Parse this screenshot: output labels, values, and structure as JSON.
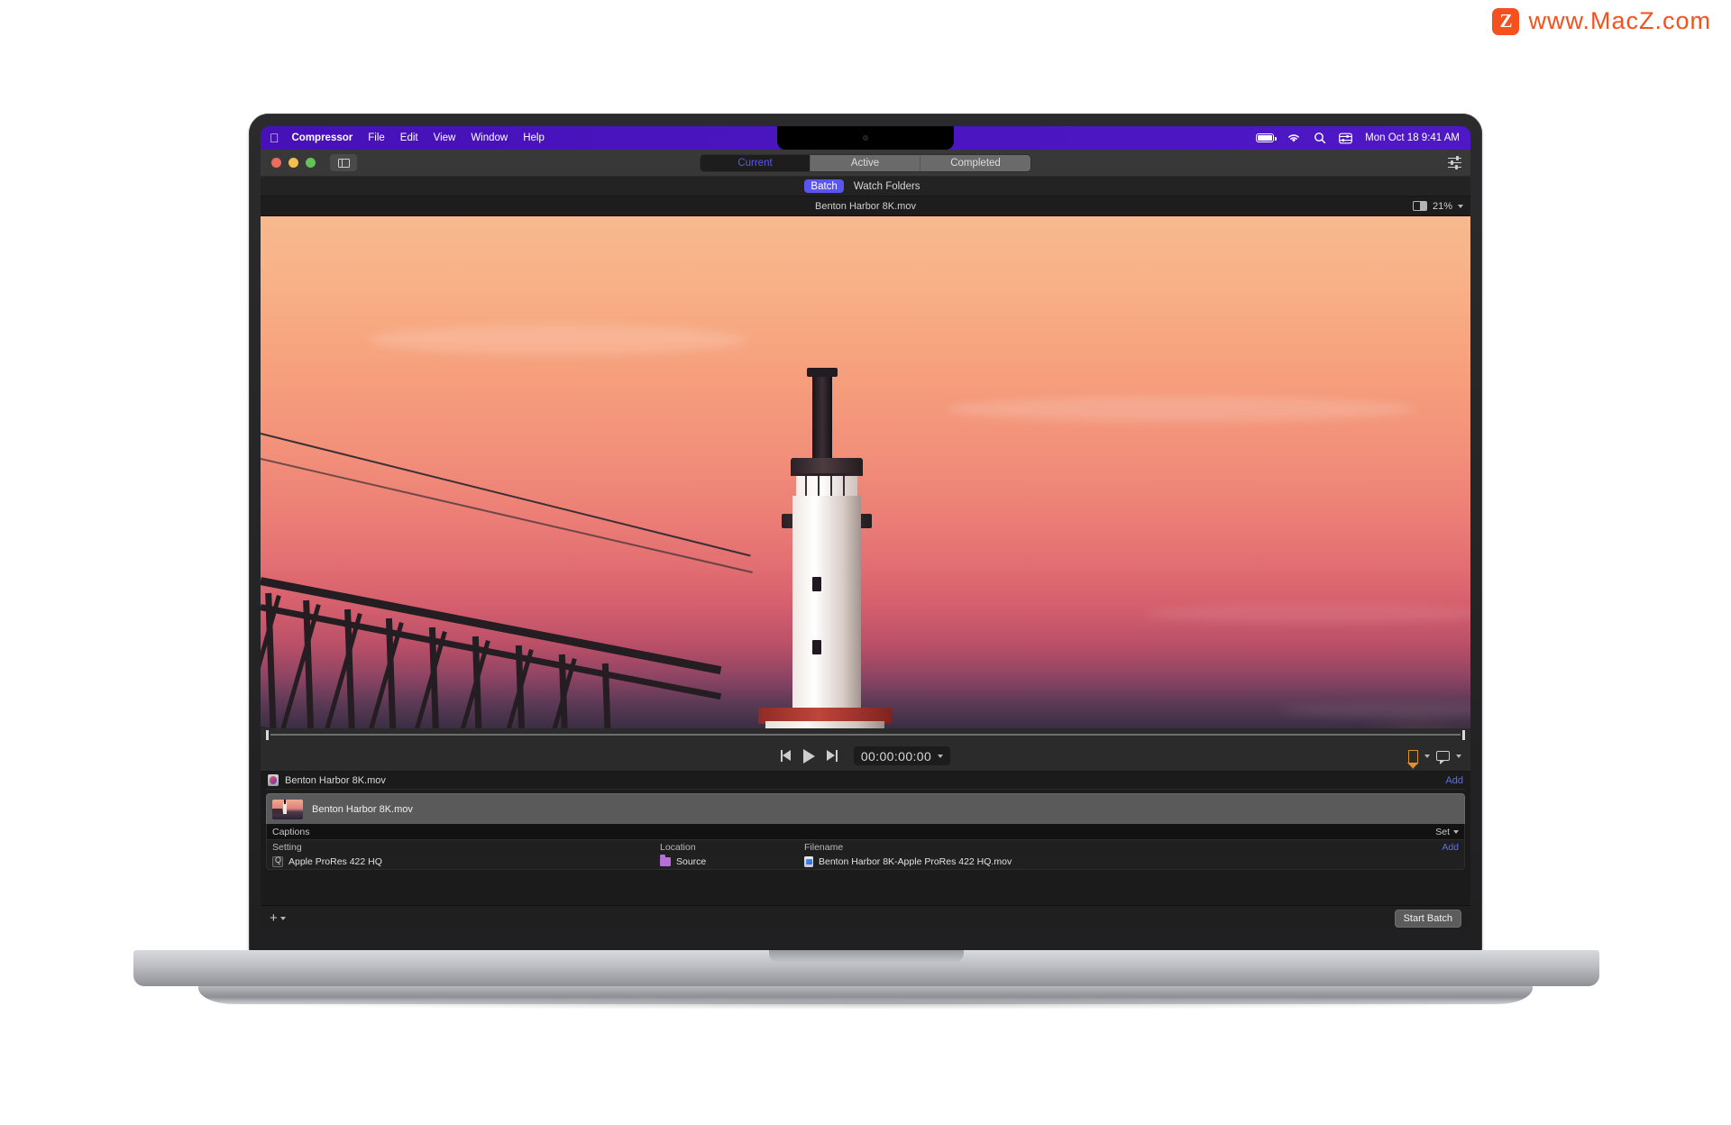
{
  "watermark": {
    "badge": "Z",
    "text": "www.MacZ.com",
    "color": "#f4511e"
  },
  "menubar": {
    "apple_icon": "apple-logo-icon",
    "items": [
      {
        "label": "Compressor",
        "bold": true
      },
      {
        "label": "File",
        "bold": false
      },
      {
        "label": "Edit",
        "bold": false
      },
      {
        "label": "View",
        "bold": false
      },
      {
        "label": "Window",
        "bold": false
      },
      {
        "label": "Help",
        "bold": false
      }
    ],
    "status_icons": [
      "battery-icon",
      "wifi-icon",
      "search-icon",
      "control-center-icon"
    ],
    "clock": "Mon Oct 18  9:41 AM",
    "accent": "#4a14c0"
  },
  "toolbar": {
    "window_controls": [
      "close-button",
      "minimize-button",
      "zoom-button"
    ],
    "sidebar_toggle": "sidebar-toggle-icon",
    "tabs": [
      {
        "label": "Current",
        "selected": true
      },
      {
        "label": "Active",
        "selected": false
      },
      {
        "label": "Completed",
        "selected": false
      }
    ],
    "settings_icon": "sliders-icon",
    "selected_tab_color": "#5b55f0"
  },
  "subtabs": [
    {
      "label": "Batch",
      "selected": true
    },
    {
      "label": "Watch Folders",
      "selected": false
    }
  ],
  "preview": {
    "title": "Benton Harbor 8K.mov",
    "view_icon": "split-view-icon",
    "zoom_level": "21%",
    "zoom_chevron": "chevron-down-icon"
  },
  "transport": {
    "previous_label": "go-to-start",
    "play_label": "play",
    "next_label": "go-to-end",
    "timecode": "00:00:00:00",
    "timecode_chevron": "chevron-down-icon",
    "bookmark_icon": "bookmark-icon",
    "bookmark_color": "#e0912f",
    "caption_icon": "caption-icon"
  },
  "job": {
    "header": {
      "icon": "quicktime-movie-icon",
      "name": "Benton Harbor 8K.mov",
      "add_label": "Add"
    },
    "source_row": {
      "thumbnail": "video-thumbnail",
      "name": "Benton Harbor 8K.mov"
    },
    "captions_row": {
      "label": "Captions",
      "set_label": "Set",
      "set_chevron": "chevron-down-icon"
    },
    "columns": [
      {
        "key": "setting",
        "label": "Setting"
      },
      {
        "key": "location",
        "label": "Location"
      },
      {
        "key": "filename",
        "label": "Filename"
      }
    ],
    "add_label": "Add",
    "rows": [
      {
        "setting": "Apple ProRes 422 HQ",
        "setting_icon": "compressor-setting-icon",
        "location": "Source",
        "location_icon": "folder-icon",
        "filename": "Benton Harbor 8K-Apple ProRes 422 HQ.mov",
        "filename_icon": "output-file-icon"
      }
    ]
  },
  "bottombar": {
    "add_button": "+",
    "add_chevron": "chevron-down-icon",
    "start_batch_label": "Start Batch"
  }
}
